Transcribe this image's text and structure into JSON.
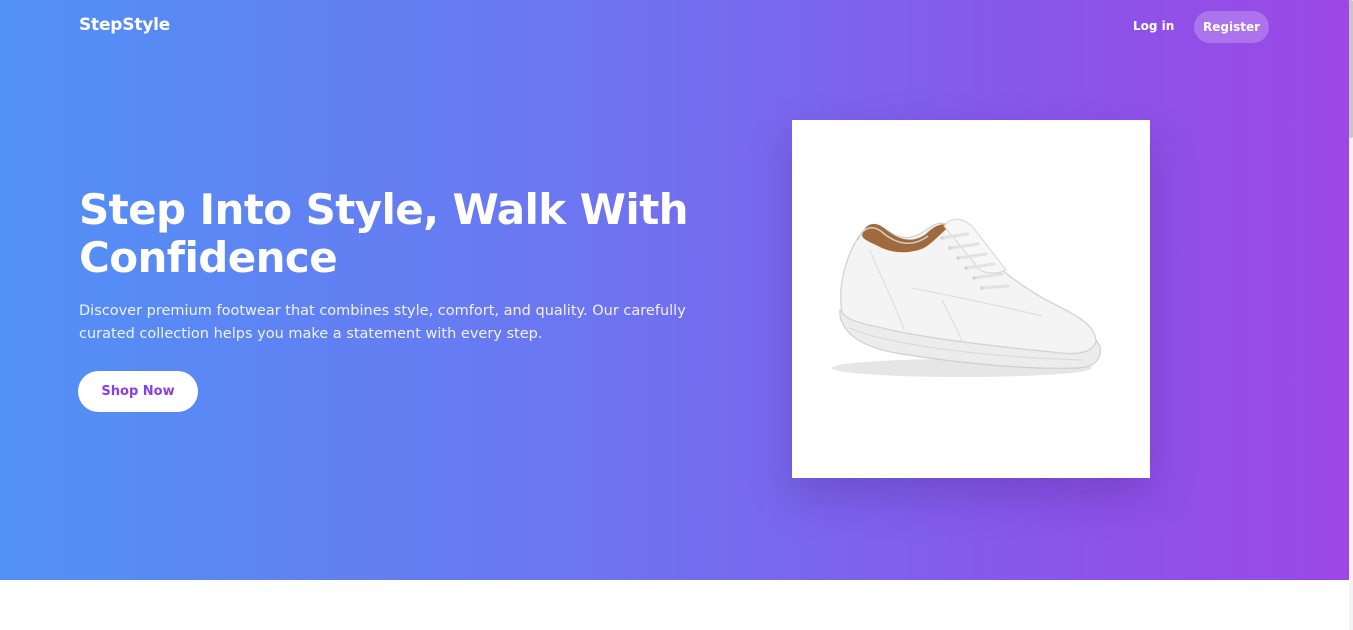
{
  "nav": {
    "brand": "StepStyle",
    "login_label": "Log in",
    "register_label": "Register"
  },
  "hero": {
    "headline_line1": "Step Into Style, Walk With",
    "headline_line2": "Confidence",
    "description_line1": "Discover premium footwear that combines style, comfort, and quality. Our carefully",
    "description_line2": "curated collection helps you make a statement with every step.",
    "cta_label": "Shop Now",
    "product_image": "white-sneaker-image"
  },
  "colors": {
    "gradient_start": "#5191f6",
    "gradient_end": "#9c47e6",
    "cta_text": "#8a3fe0"
  }
}
